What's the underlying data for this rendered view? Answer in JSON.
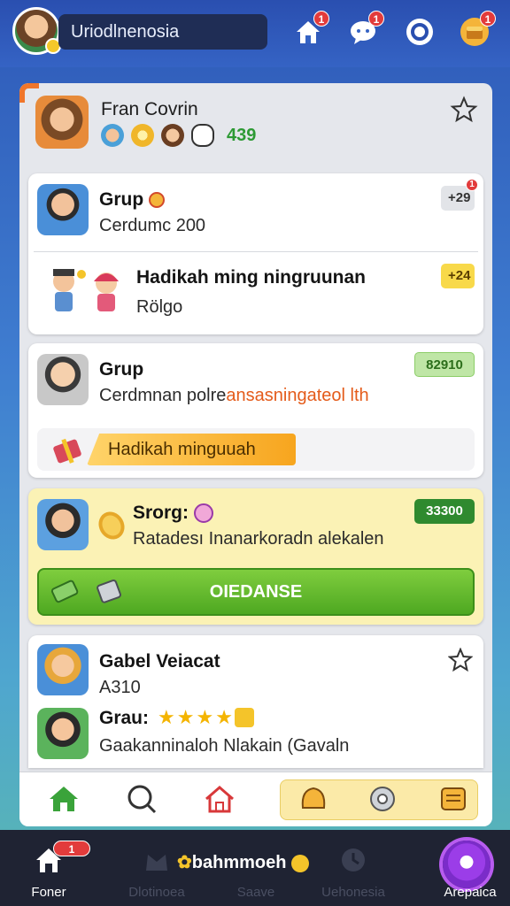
{
  "topbar": {
    "search_value": "Uriodlnenosia",
    "badges": [
      "1",
      "1",
      "1"
    ]
  },
  "profile": {
    "name": "Fran Covrin",
    "score": "439"
  },
  "cards": [
    {
      "title": "Grup",
      "subtitle": "Cerdumc 200",
      "pill": "+29",
      "pill_badge": "1",
      "subtitle2": "Hadikah ming ningruunan",
      "sub2": "Rölgo",
      "pill2": "+24"
    },
    {
      "title": "Grup",
      "subtitle_a": "Cerdmnan polre",
      "subtitle_b": "ansasningateol lth",
      "pill": "82910",
      "banner": "Hadikah minguuah"
    },
    {
      "title": "Srorg:",
      "subtitle": "Ratadesı Inanarkoradn alekalen",
      "pill": "33300",
      "button": "OIEDANSE"
    },
    {
      "title": "Gabel Veiacat",
      "subtitle": "A310",
      "title2": "Grau:",
      "sub2": "Gaakanninaloh Nlakain (Gavaln"
    }
  ],
  "bottom_nav": {
    "items": [
      {
        "label": "Foner",
        "badge": "1"
      },
      {
        "label": "Dlotinoea"
      },
      {
        "label": "Saave"
      },
      {
        "label": "Uehonesia"
      },
      {
        "label": "Arepaica"
      }
    ],
    "center": "bahmmoeh"
  },
  "colors": {
    "accent_green": "#4ea821",
    "accent_yellow": "#f8d94a",
    "notif_red": "#e23b3b",
    "nav_bg": "#1f2333"
  }
}
